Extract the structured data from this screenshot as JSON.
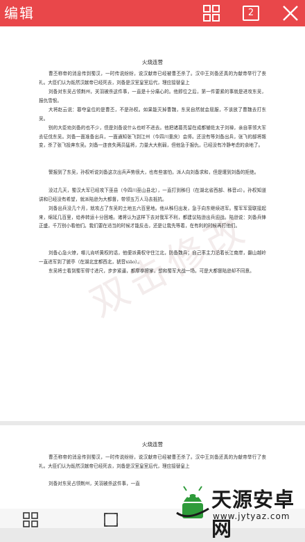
{
  "toolbar": {
    "edit_label": "编辑",
    "page_count": "2",
    "icons": [
      "grid-icon",
      "page-count-icon",
      "close-icon"
    ]
  },
  "document": {
    "title": "火烧连营",
    "paragraphs": [
      "曹丕称帝的消息传到蜀汉，一时传说纷纷，说汉献帝已经被曹丕杀了。汉中王刘备还真的为献帝举行了丧礼。大臣们认为既然汉献帝已经死去，刘备是汉室皇室后代，理应接替皇上",
      "刘备对东吴占领荆州，关羽被杀这件事，一直是十分痛心的。他即位之后，第一件要紧的事就是进攻东吴，报仇雪恨。",
      "大将赵云说：篡夺皇位的是曹丕，不是孙权。如果能灭掉曹魏，东吴自然就会屈服，不该放了曹魏去打东吴。",
      "别的大臣劝刘备的也不少，但是刘备说什么也听不进去。他把诸葛亮留在成都辅佐太子刘禅，亲自率领大军去征伐东吴。刘备一面准备出兵，一面通知张飞到江州（今四川重庆）会师。还没有等刘备出兵，张飞的部将叛变，杀了张飞投奔东吴。刘备一连丧失两员猛将，力量大大削弱，但他急于报仇，已经没有冷静考虑的余地了。",
      "警报到了东吴，孙权听说刘备这次出兵声势很大，也有些害怕，派人向刘备求和，但是遭到刘备的拒绝。",
      "没过几天，蜀汉大军已经攻下巫县（今四川巫山县北），一直打到秭归（在湖北省西部、秭音zǐ）。孙权知道讲和已经没有希望，就派陆逊为大都督，带领五万人马去抵抗。",
      "刘备出兵没几个月，就攻占了东吴的土地五六百里地。他从秭归出发，急于向东继续进军。蜀军军营联接起来，绵延几百里，给养转运十分困难。诸将认为这样下去对我军不利，都建议陆逊出兵迎战。陆逊说：刘备兵锋正盛，千万别小看他们。我们要在适当的时候才能反击，还是让我先等着，在有利的时候再打他们。",
      "刘备心急火燎，哪儿肯听黄权的话，他便派黄权守住江北，防备魏兵；自己率主力沿着长江南岸，翻山越岭一直进军到了猇亭（在湖北宜都西北，猇音xiāo）。",
      "东吴将士看到蜀军得寸进尺，步步紧逼，都摩拳擦掌，想和蜀军大战一场。可是大都督陆逊却不同意。"
    ],
    "page2_title": "火烧连营",
    "page2_paragraphs": [
      "曹丕称帝的消息传到蜀汉，一时传说纷纷，说汉献帝已经被曹丕杀了。汉中王刘备还真的为献帝举行了丧礼。大臣们认为既然汉献帝已经死去，刘备是汉室皇室后代，理应接替皇上",
      "刘备对东吴占领荆州，关羽被杀这件事，一直"
    ],
    "watermark": "双击修改"
  },
  "bottom_toolbar": {
    "icons": [
      "thumbnail-grid-icon",
      "fit-page-icon"
    ]
  },
  "site_watermark": {
    "name": "天源安卓网",
    "url": "www.jytyaz.com"
  }
}
